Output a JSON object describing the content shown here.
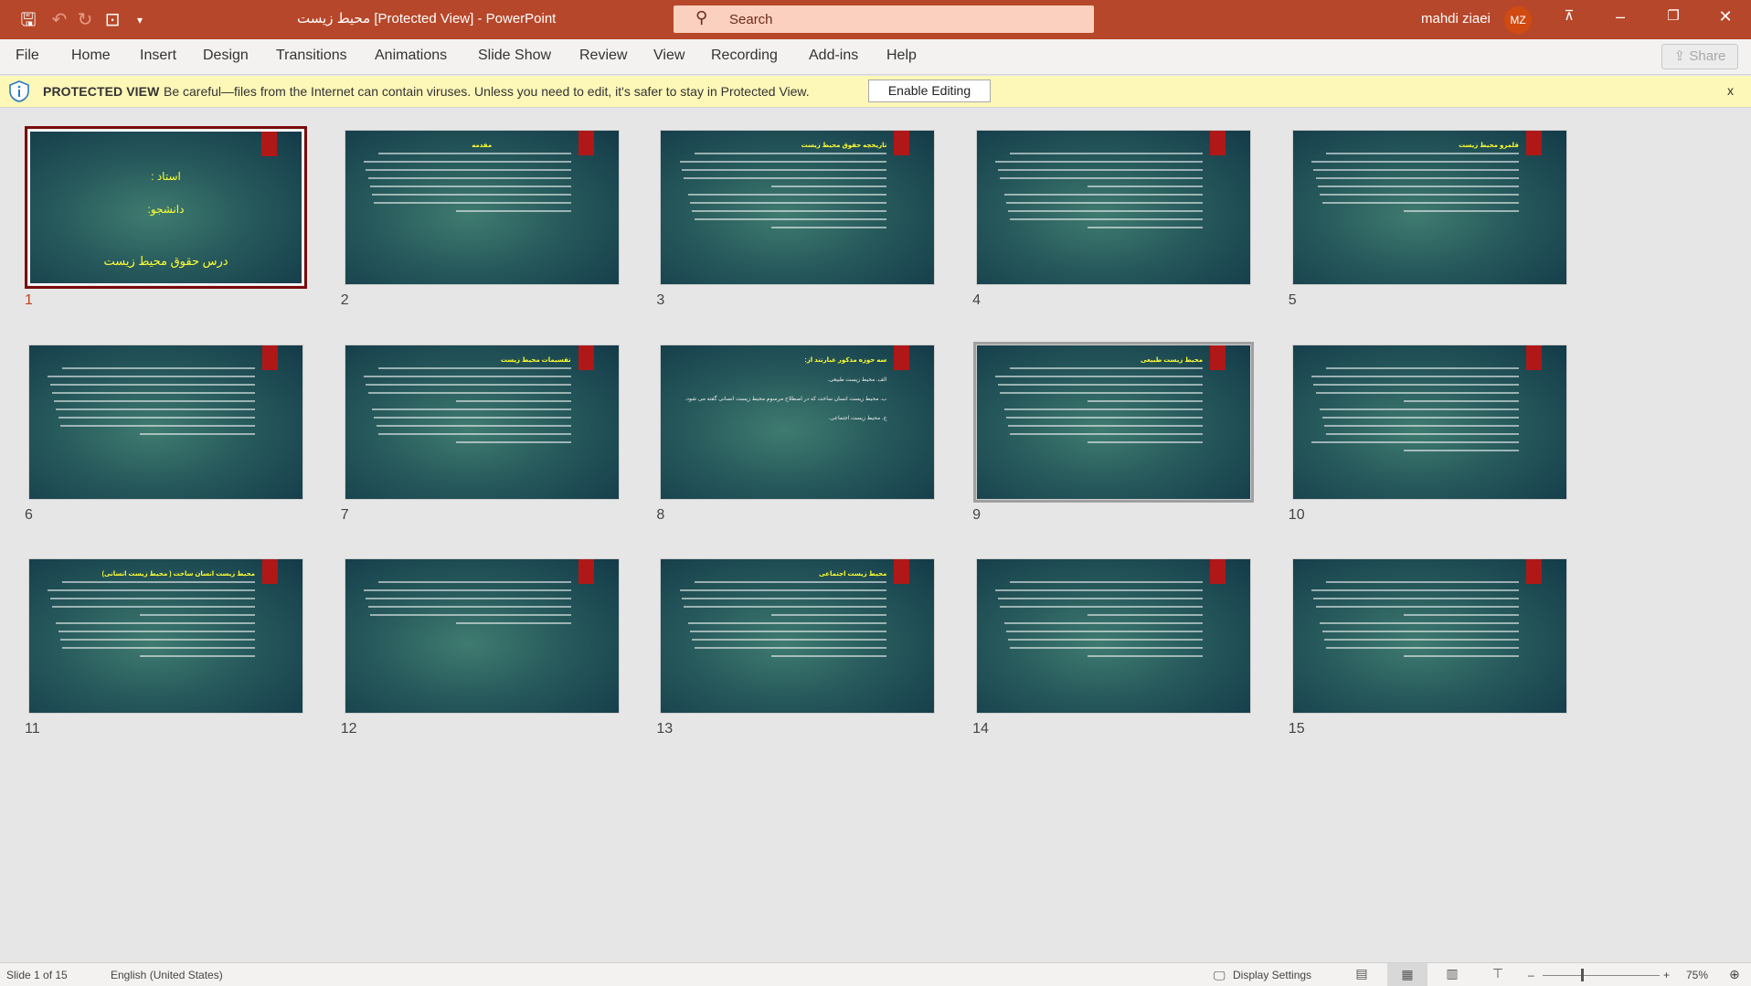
{
  "app": {
    "title": "محیط زیست [Protected View]  -  PowerPoint",
    "search_placeholder": "Search",
    "user_name": "mahdi ziaei",
    "user_initials": "MZ"
  },
  "ribbon": {
    "tabs": [
      "File",
      "Home",
      "Insert",
      "Design",
      "Transitions",
      "Animations",
      "Slide Show",
      "Review",
      "View",
      "Recording",
      "Add-ins",
      "Help"
    ],
    "share": "Share"
  },
  "protected_view": {
    "label": "PROTECTED VIEW",
    "message": "Be careful—files from the Internet can contain viruses. Unless you need to edit, it's safer to stay in Protected View.",
    "button": "Enable Editing",
    "close": "x"
  },
  "slide1": {
    "line1": "استاد :",
    "line2": "دانشجو:",
    "line3": "درس حقوق محیط زیست"
  },
  "slides": [
    {
      "num": "1"
    },
    {
      "num": "2",
      "title": "مقدمه"
    },
    {
      "num": "3",
      "title": "تاریخچه حقوق محیط زیست"
    },
    {
      "num": "4",
      "title": ""
    },
    {
      "num": "5",
      "title": "قلمرو محیط زیست"
    },
    {
      "num": "6",
      "title": ""
    },
    {
      "num": "7",
      "title": "تقسیمات محیط زیست"
    },
    {
      "num": "8",
      "title": "سه حوزه مذکور عبارتند از:",
      "items": [
        "الف. محیط زیست طبیعی.",
        "ب. محیط زیست انسان ساخت که در اصطلاح مرسوم محیط زیست انسانی گفته می شود.",
        "ج. محیط زیست اجتماعی."
      ]
    },
    {
      "num": "9",
      "title": "محیط زیست طبیعی"
    },
    {
      "num": "10",
      "title": ""
    },
    {
      "num": "11",
      "title": "محیط زیست انسان ساخت ( محیط زیست انسانی)"
    },
    {
      "num": "12",
      "title": ""
    },
    {
      "num": "13",
      "title": "محیط زیست اجتماعی"
    },
    {
      "num": "14",
      "title": ""
    },
    {
      "num": "15",
      "title": ""
    }
  ],
  "selected_slide": 1,
  "status": {
    "slide_info": "Slide 1 of 15",
    "language": "English (United States)",
    "display_settings": "Display Settings",
    "zoom": "75%"
  },
  "colors": {
    "title_bar": "#b7472a",
    "protected_bar": "#fdf7b8",
    "accent": "#c43e1c"
  }
}
